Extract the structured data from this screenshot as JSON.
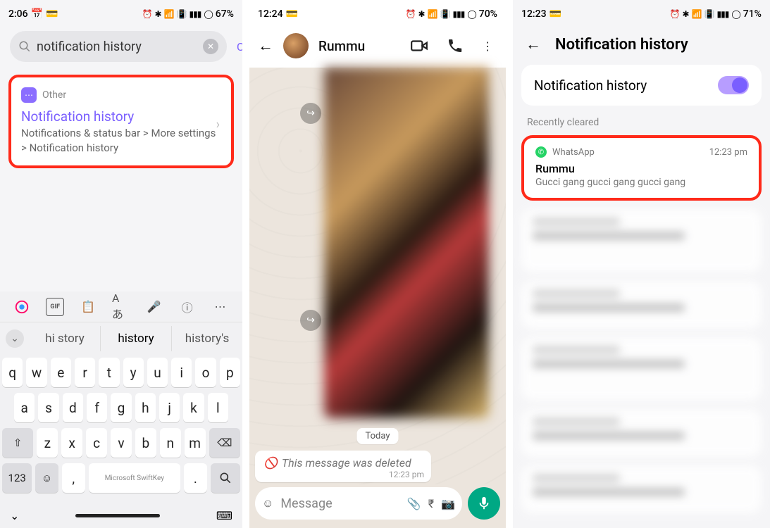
{
  "p1": {
    "status": {
      "time": "2:06",
      "battery": "67%"
    },
    "search": {
      "value": "notification history",
      "cancel": "Cancel"
    },
    "result": {
      "category": "Other",
      "title": "Notification history",
      "path": "Notifications & status bar > More settings > Notification history"
    },
    "suggestions": {
      "s1": "hi story",
      "s2": "history",
      "s3": "history's"
    },
    "keyboard": {
      "row1": [
        "q",
        "w",
        "e",
        "r",
        "t",
        "y",
        "u",
        "i",
        "o",
        "p"
      ],
      "row2": [
        "a",
        "s",
        "d",
        "f",
        "g",
        "h",
        "j",
        "k",
        "l"
      ],
      "row3": [
        "z",
        "x",
        "c",
        "v",
        "b",
        "n",
        "m"
      ],
      "num": "123",
      "space": "Microsoft SwiftKey"
    }
  },
  "p2": {
    "status": {
      "time": "12:24",
      "battery": "70%"
    },
    "header": {
      "name": "Rummu"
    },
    "date": "Today",
    "deleted": {
      "text": "This message was deleted",
      "time": "12:23 pm"
    },
    "input": {
      "placeholder": "Message"
    }
  },
  "p3": {
    "status": {
      "time": "12:23",
      "battery": "71%"
    },
    "title": "Notification history",
    "toggle_label": "Notification history",
    "section": "Recently cleared",
    "notif": {
      "app": "WhatsApp",
      "time": "12:23 pm",
      "title": "Rummu",
      "body": "Gucci gang gucci gang gucci gang"
    }
  }
}
